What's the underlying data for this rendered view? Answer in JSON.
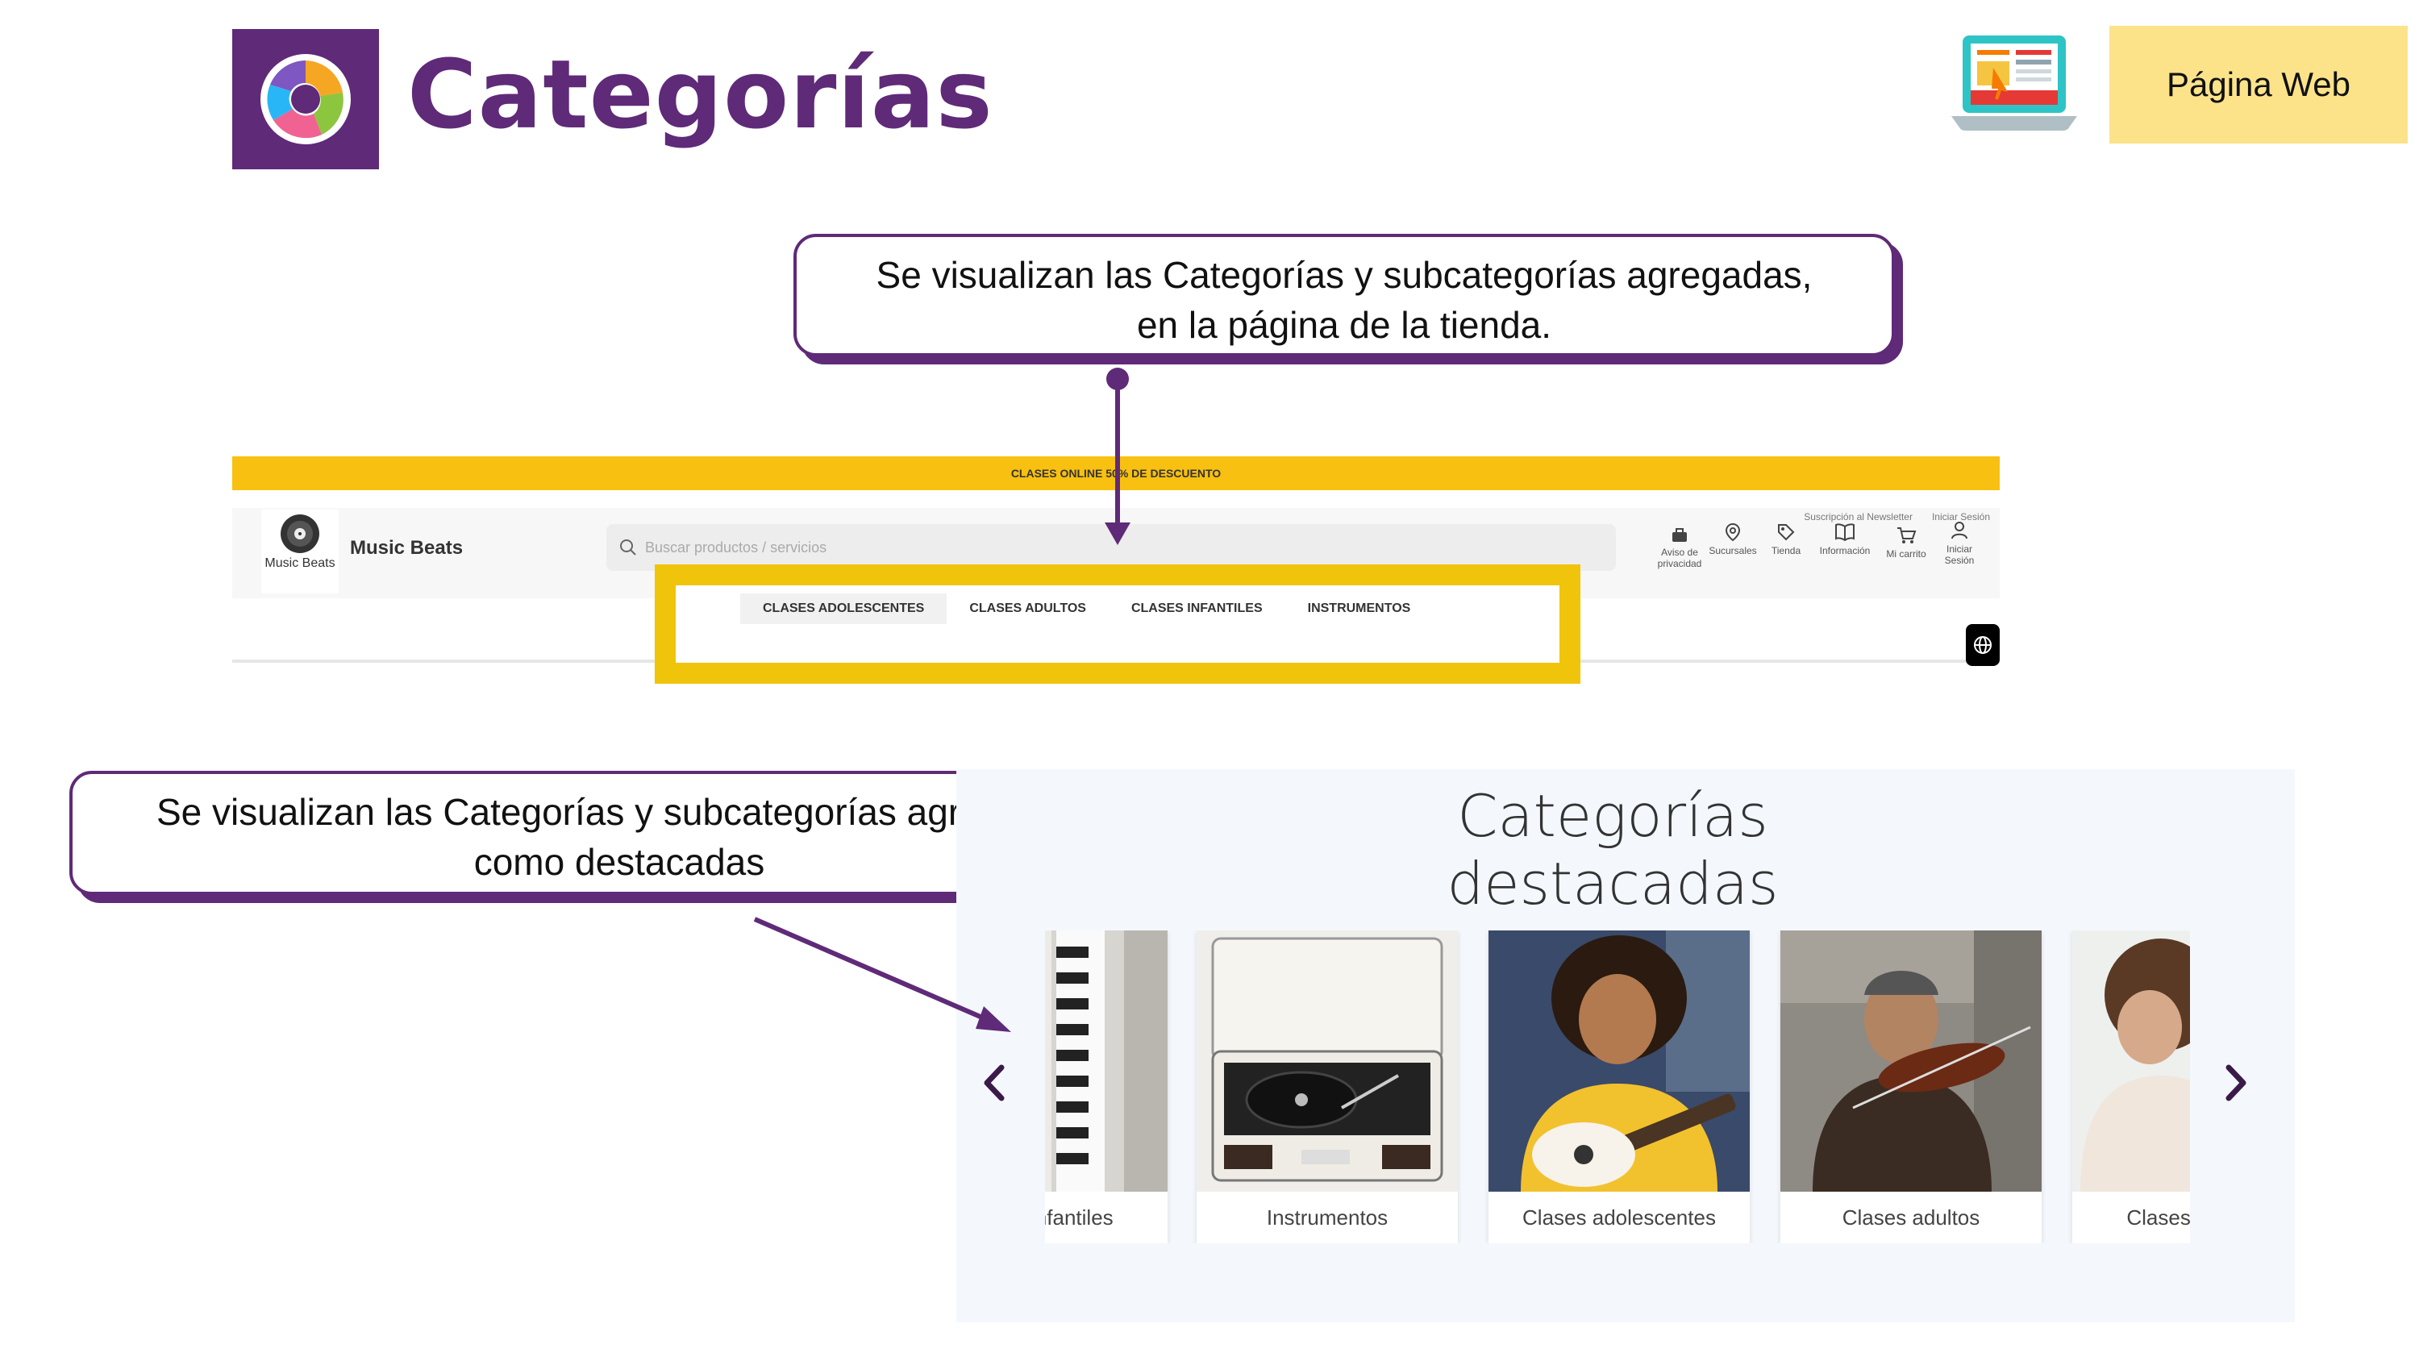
{
  "header": {
    "title": "Categorías",
    "badge_label": "Página Web"
  },
  "callouts": {
    "top_line1": "Se visualizan las Categorías y subcategorías agregadas,",
    "top_line2": "en la página de la tienda.",
    "bottom_line1": "Se visualizan las Categorías y subcategorías agregadas",
    "bottom_line2": "como destacadas"
  },
  "store": {
    "promo_text": "CLASES ONLINE 50% DE DESCUENTO",
    "top_links": [
      "Suscripción al Newsletter",
      "Iniciar Sesión"
    ],
    "logo_text": "Music Beats",
    "name": "Music Beats",
    "search_placeholder": "Buscar productos / servicios",
    "actions": [
      {
        "label1": "Aviso de",
        "label2": "privacidad",
        "icon": "briefcase-icon"
      },
      {
        "label1": "Sucursales",
        "label2": "",
        "icon": "location-pin-icon"
      },
      {
        "label1": "Tienda",
        "label2": "",
        "icon": "tag-icon"
      },
      {
        "label1": "Información",
        "label2": "",
        "icon": "book-icon"
      },
      {
        "label1": "Mi carrito",
        "label2": "",
        "icon": "cart-icon"
      },
      {
        "label1": "Iniciar",
        "label2": "Sesión",
        "icon": "user-icon"
      }
    ],
    "categories": [
      "CLASES ADOLESCENTES",
      "CLASES ADULTOS",
      "CLASES INFANTILES",
      "INSTRUMENTOS"
    ]
  },
  "featured": {
    "title": "Categorías destacadas",
    "cards": [
      "Clases infantiles",
      "Instrumentos",
      "Clases adolescentes",
      "Clases adultos",
      "Clases infantiles"
    ]
  },
  "colors": {
    "brand_purple": "#5f2a78",
    "promo_yellow": "#f8c010",
    "highlight_yellow": "#f0c40a",
    "badge_yellow": "#fce38a"
  }
}
